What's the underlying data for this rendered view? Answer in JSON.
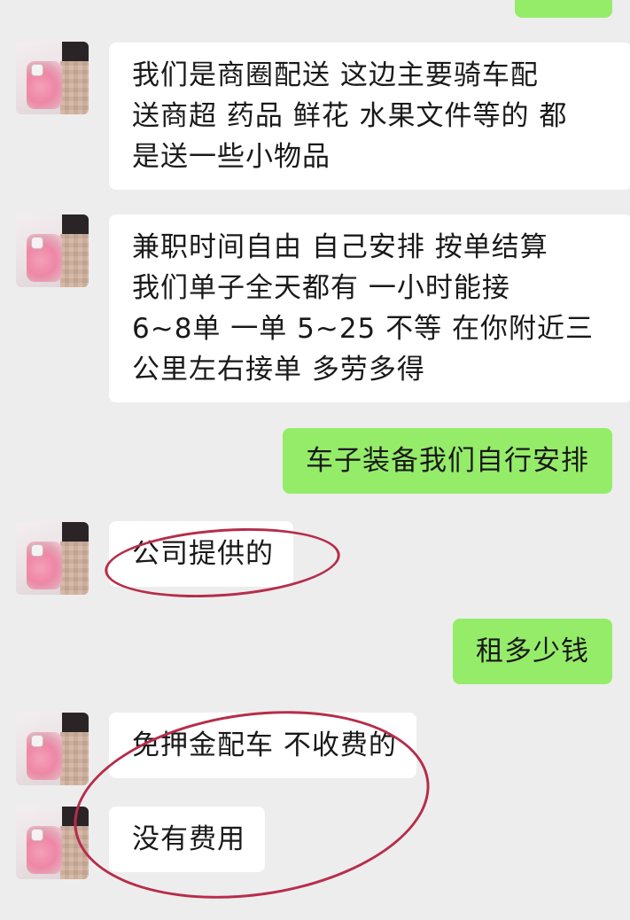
{
  "chat": {
    "messages": [
      {
        "from": "other",
        "text": "我们是商圈配送 这边主要骑车配\n送商超 药品 鲜花 水果文件等的 都\n是送一些小物品"
      },
      {
        "from": "other",
        "text": "兼职时间自由 自己安排 按单结算\n我们单子全天都有 一小时能接\n6~8单 一单 5~25 不等 在你附近三\n公里左右接单 多劳多得"
      },
      {
        "from": "self",
        "text": "车子装备我们自行安排"
      },
      {
        "from": "other",
        "text": "公司提供的"
      },
      {
        "from": "self",
        "text": "租多少钱"
      },
      {
        "from": "other",
        "text": "免押金配车 不收费的"
      },
      {
        "from": "other",
        "text": "没有费用"
      }
    ]
  },
  "colors": {
    "background": "#ededed",
    "incoming_bubble": "#ffffff",
    "outgoing_bubble": "#95ec69",
    "annotation_circle": "#b62d4b"
  },
  "icons": {
    "avatar": "contact-avatar-icon"
  }
}
